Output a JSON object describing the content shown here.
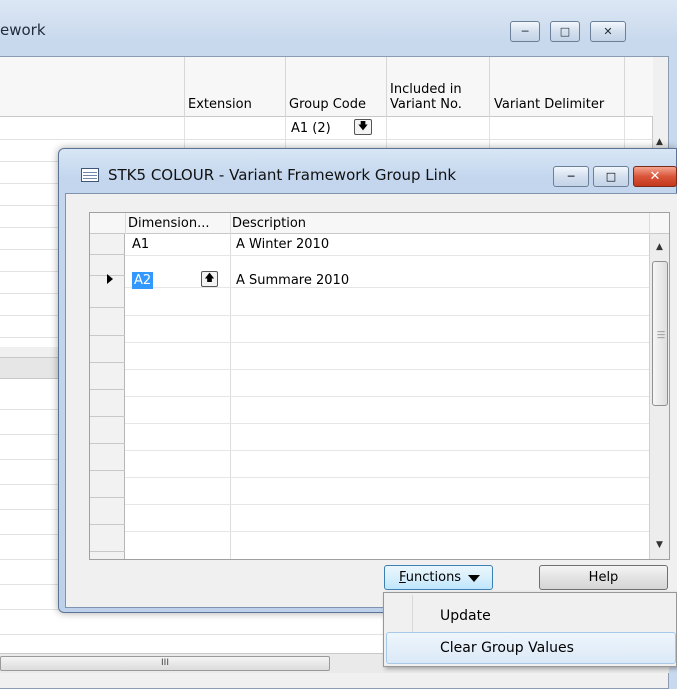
{
  "background_window": {
    "title": "ework",
    "columns": {
      "extension": "Extension",
      "group_code": "Group Code",
      "included_line1": "Included in",
      "included_line2": "Variant No.",
      "variant_delimiter": "Variant Delimiter"
    },
    "row1_group_code": "A1 (2)",
    "hscroll_grip": "III"
  },
  "dialog": {
    "title": "STK5 COLOUR - Variant Framework Group Link",
    "columns": {
      "dimension": "Dimension...",
      "description": "Description"
    },
    "rows": [
      {
        "dimension": "A1",
        "description": "A Winter 2010"
      },
      {
        "dimension": "A2",
        "description": "A Summare 2010"
      }
    ],
    "buttons": {
      "functions_first_letter": "F",
      "functions_rest": "unctions",
      "help": "Help"
    }
  },
  "menu": {
    "items": [
      {
        "label": "Update"
      },
      {
        "label": "Clear Group Values"
      }
    ]
  },
  "icons": {
    "minimize": "minimize-icon",
    "maximize": "maximize-icon",
    "close": "close-icon",
    "lookup": "lookup-arrow-icon",
    "table_window": "table-window-icon"
  },
  "colors": {
    "selection": "#3399ff",
    "close_button": "#d9553a"
  }
}
